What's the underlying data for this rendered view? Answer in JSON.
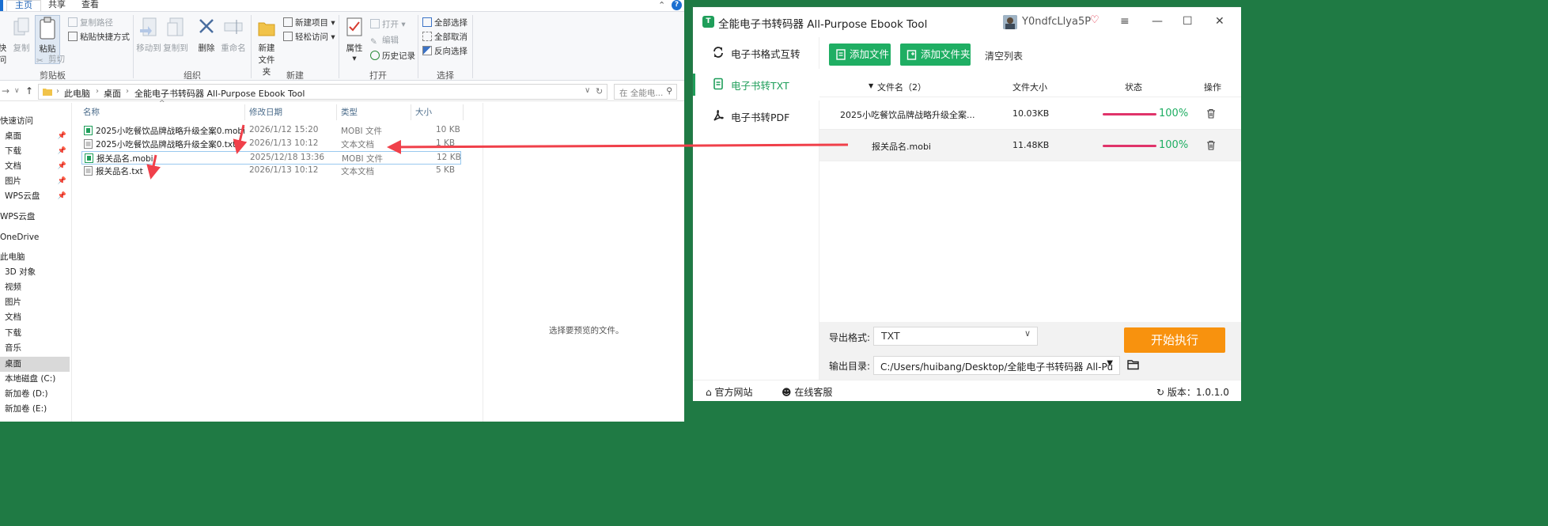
{
  "explorer": {
    "ribbon_tabs": [
      "主页",
      "共享",
      "查看"
    ],
    "ribbon": {
      "clipboard": {
        "copy": "复制",
        "paste": "粘贴",
        "copy_path": "复制路径",
        "paste_shortcut": "粘贴快捷方式",
        "cut": "剪切",
        "group": "剪贴板",
        "quick_left": "快",
        "quick_left2": "问"
      },
      "organize": {
        "move_to": "移动到",
        "copy_to": "复制到",
        "delete": "删除",
        "rename": "重命名",
        "group": "组织"
      },
      "new": {
        "new_folder_1": "新建",
        "new_folder_2": "文件夹",
        "new_item": "新建项目",
        "easy_access": "轻松访问",
        "group": "新建"
      },
      "open": {
        "properties": "属性",
        "open": "打开",
        "edit": "编辑",
        "history": "历史记录",
        "group": "打开"
      },
      "select": {
        "select_all": "全部选择",
        "select_none": "全部取消",
        "invert": "反向选择",
        "group": "选择"
      }
    },
    "address": {
      "crumbs": [
        "此电脑",
        "桌面",
        "全能电子书转码器 All-Purpose Ebook Tool"
      ],
      "search_placeholder": "在 全能电..."
    },
    "sidebar": [
      {
        "label": "快速访问"
      },
      {
        "label": "桌面"
      },
      {
        "label": "下载"
      },
      {
        "label": "文档"
      },
      {
        "label": "图片"
      },
      {
        "label": "WPS云盘"
      },
      {
        "label": "WPS云盘"
      },
      {
        "label": "OneDrive"
      },
      {
        "label": "此电脑"
      },
      {
        "label": "3D 对象"
      },
      {
        "label": "视频"
      },
      {
        "label": "图片"
      },
      {
        "label": "文档"
      },
      {
        "label": "下载"
      },
      {
        "label": "音乐"
      },
      {
        "label": "桌面"
      },
      {
        "label": "本地磁盘 (C:)"
      },
      {
        "label": "新加卷 (D:)"
      },
      {
        "label": "新加卷 (E:)"
      }
    ],
    "columns": {
      "name": "名称",
      "date": "修改日期",
      "type": "类型",
      "size": "大小"
    },
    "files": [
      {
        "name": "2025小吃餐饮品牌战略升级全案0.mobi",
        "date": "2026/1/12 15:20",
        "type": "MOBI 文件",
        "size": "10 KB"
      },
      {
        "name": "2025小吃餐饮品牌战略升级全案0.txt",
        "date": "2026/1/13 10:12",
        "type": "文本文档",
        "size": "1 KB"
      },
      {
        "name": "报关品名.mobi",
        "date": "2025/12/18 13:36",
        "type": "MOBI 文件",
        "size": "12 KB"
      },
      {
        "name": "报关品名.txt",
        "date": "2026/1/13 10:12",
        "type": "文本文档",
        "size": "5 KB"
      }
    ],
    "preview_text": "选择要预览的文件。"
  },
  "app": {
    "title": "全能电子书转码器 All-Purpose Ebook Tool",
    "logo_text": "T",
    "user": "Y0ndfcLlya5P",
    "menu": [
      {
        "label": "电子书格式互转"
      },
      {
        "label": "电子书转TXT"
      },
      {
        "label": "电子书转PDF"
      }
    ],
    "toolbar": {
      "add_file": "添加文件",
      "add_folder": "添加文件夹",
      "clear": "清空列表"
    },
    "table": {
      "headers": {
        "name": "文件名（2）",
        "size": "文件大小",
        "status": "状态",
        "op": "操作"
      },
      "rows": [
        {
          "name": "2025小吃餐饮品牌战略升级全案...",
          "size": "10.03KB",
          "progress": "100%"
        },
        {
          "name": "报关品名.mobi",
          "size": "11.48KB",
          "progress": "100%"
        }
      ]
    },
    "export": {
      "format_label": "导出格式:",
      "format_value": "TXT",
      "dir_label": "输出目录:",
      "dir_value": "C:/Users/huibang/Desktop/全能电子书转码器 All-Pu",
      "start": "开始执行"
    },
    "footer": {
      "website": "官方网站",
      "support": "在线客服",
      "version": "版本：1.0.1.0"
    }
  },
  "colors": {
    "accent_green": "#1fae63",
    "start_orange": "#f8920e",
    "progress_pink": "#e0336a",
    "arrow_red": "#f0404a"
  }
}
